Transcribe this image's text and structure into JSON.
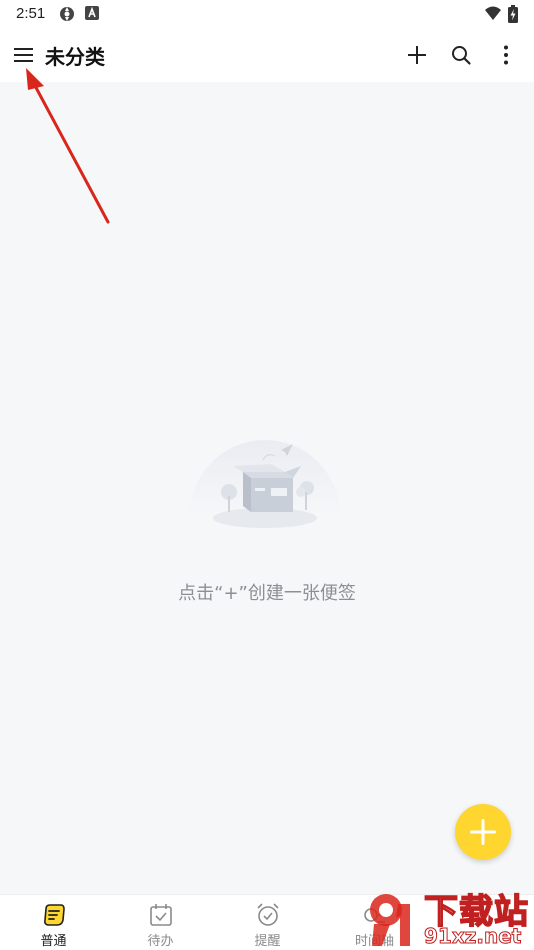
{
  "status_bar": {
    "time": "2:51",
    "icons": [
      "gear-icon",
      "app-a-icon",
      "wifi-icon",
      "battery-charging-icon"
    ]
  },
  "header": {
    "title": "未分类",
    "actions": [
      "add-icon",
      "search-icon",
      "more-vertical-icon"
    ]
  },
  "empty_state": {
    "message": "点击“+”创建一张便签"
  },
  "fab": {
    "icon": "plus-icon",
    "color": "#ffd530"
  },
  "bottom_nav": {
    "items": [
      {
        "label": "普通",
        "icon": "note-icon",
        "active": true
      },
      {
        "label": "待办",
        "icon": "calendar-check-icon",
        "active": false
      },
      {
        "label": "提醒",
        "icon": "alarm-clock-icon",
        "active": false
      },
      {
        "label": "时间轴",
        "icon": "timeline-icon",
        "active": false
      }
    ]
  },
  "watermark": {
    "title": "下载站",
    "url": "91xz.net"
  },
  "colors": {
    "accent": "#ffd530",
    "annotation_arrow": "#d9261c",
    "background": "#f6f7f9"
  }
}
